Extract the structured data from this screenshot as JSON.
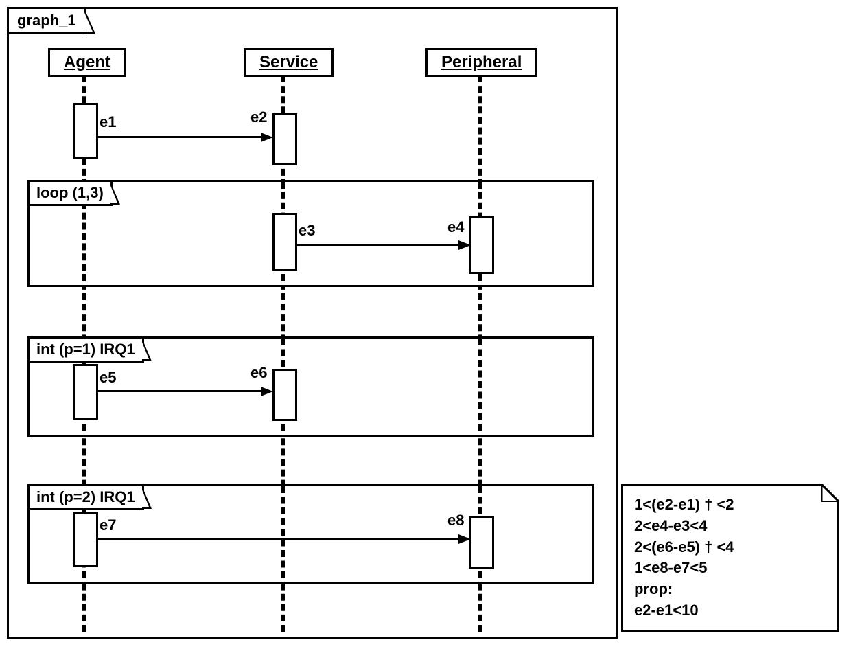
{
  "frame": {
    "title": "graph_1"
  },
  "lifelines": [
    {
      "name": "Agent"
    },
    {
      "name": "Service"
    },
    {
      "name": "Peripheral"
    }
  ],
  "events": {
    "e1": "e1",
    "e2": "e2",
    "e3": "e3",
    "e4": "e4",
    "e5": "e5",
    "e6": "e6",
    "e7": "e7",
    "e8": "e8"
  },
  "fragments": {
    "loop": "loop (1,3)",
    "int1": "int (p=1) IRQ1",
    "int2": "int (p=2) IRQ1"
  },
  "note": {
    "line1": "1<(e2-e1) † <2",
    "line2": "2<e4-e3<4",
    "line3": "2<(e6-e5) † <4",
    "line4": "1<e8-e7<5",
    "line5": "prop:",
    "line6": "e2-e1<10"
  }
}
